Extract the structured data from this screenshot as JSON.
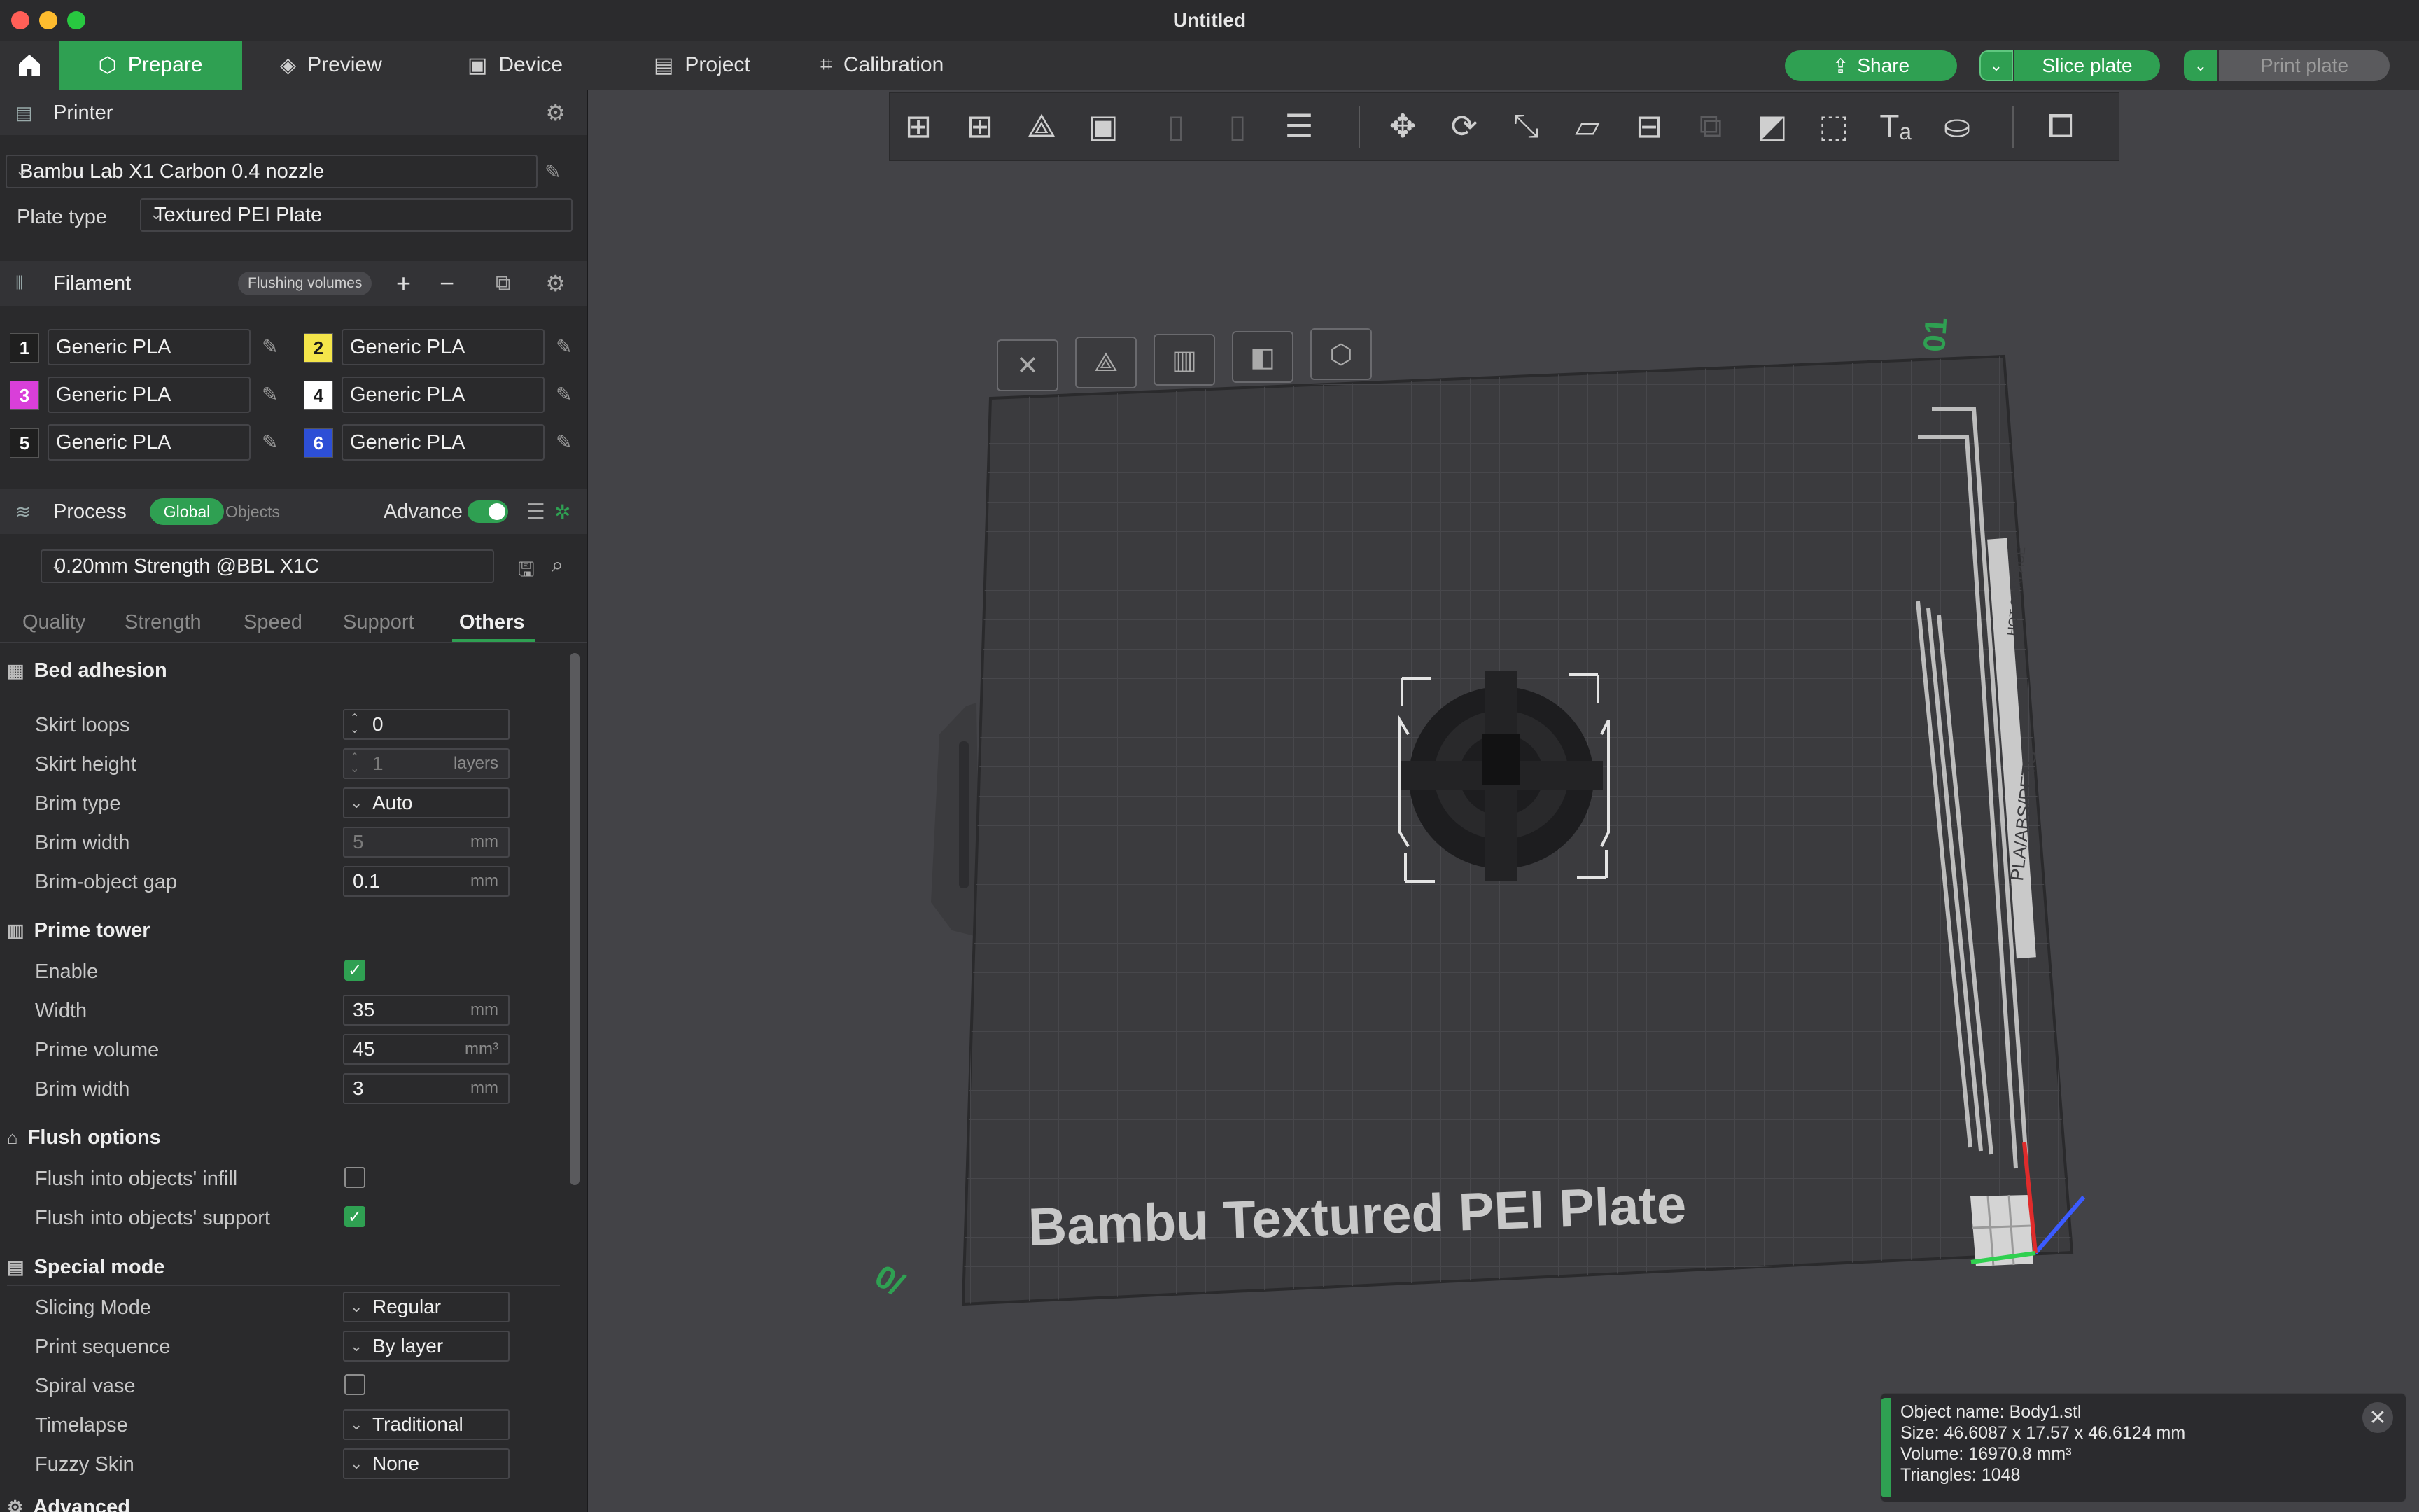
{
  "window": {
    "title": "Untitled"
  },
  "colors": {
    "accent": "#2fa052",
    "close": "#ff5f57",
    "minimize": "#febc2e",
    "zoom": "#28c840"
  },
  "nav": {
    "home_icon": "home-icon",
    "tabs": [
      {
        "label": "Prepare",
        "icon": "cube-icon"
      },
      {
        "label": "Preview",
        "icon": "layers-icon"
      },
      {
        "label": "Device",
        "icon": "device-icon"
      },
      {
        "label": "Project",
        "icon": "project-icon"
      },
      {
        "label": "Calibration",
        "icon": "calibration-icon"
      }
    ],
    "share_label": "Share",
    "slice_label": "Slice plate",
    "print_label": "Print plate"
  },
  "printer": {
    "section_title": "Printer",
    "printer_name": "Bambu Lab X1 Carbon 0.4 nozzle",
    "plate_type_label": "Plate type",
    "plate_type": "Textured PEI Plate"
  },
  "filament": {
    "section_title": "Filament",
    "flushing_label": "Flushing volumes",
    "items": [
      {
        "num": "1",
        "name": "Generic PLA",
        "color": "#1f1f1f",
        "text": "#ffffff"
      },
      {
        "num": "2",
        "name": "Generic PLA",
        "color": "#f4e54a",
        "text": "#1a1a1a"
      },
      {
        "num": "3",
        "name": "Generic PLA",
        "color": "#d93fd9",
        "text": "#ffffff"
      },
      {
        "num": "4",
        "name": "Generic PLA",
        "color": "#ffffff",
        "text": "#1a1a1a"
      },
      {
        "num": "5",
        "name": "Generic PLA",
        "color": "#1f1f1f",
        "text": "#ffffff"
      },
      {
        "num": "6",
        "name": "Generic PLA",
        "color": "#2d4fd6",
        "text": "#ffffff"
      }
    ]
  },
  "process": {
    "section_title": "Process",
    "global_label": "Global",
    "objects_label": "Objects",
    "advance_label": "Advance",
    "preset": "0.20mm Strength @BBL X1C",
    "tabs": [
      "Quality",
      "Strength",
      "Speed",
      "Support",
      "Others"
    ],
    "active_tab": "Others"
  },
  "groups": {
    "bed_adhesion": {
      "title": "Bed adhesion",
      "skirt_loops": {
        "label": "Skirt loops",
        "value": "0"
      },
      "skirt_height": {
        "label": "Skirt height",
        "value": "1",
        "unit": "layers"
      },
      "brim_type": {
        "label": "Brim type",
        "value": "Auto"
      },
      "brim_width": {
        "label": "Brim width",
        "value": "5",
        "unit": "mm"
      },
      "brim_gap": {
        "label": "Brim-object gap",
        "value": "0.1",
        "unit": "mm"
      }
    },
    "prime_tower": {
      "title": "Prime tower",
      "enable": {
        "label": "Enable",
        "checked": true
      },
      "width": {
        "label": "Width",
        "value": "35",
        "unit": "mm"
      },
      "prime_volume": {
        "label": "Prime volume",
        "value": "45",
        "unit": "mm³"
      },
      "brim_width": {
        "label": "Brim width",
        "value": "3",
        "unit": "mm"
      }
    },
    "flush_options": {
      "title": "Flush options",
      "infill": {
        "label": "Flush into objects' infill",
        "checked": false
      },
      "support": {
        "label": "Flush into objects' support",
        "checked": true
      }
    },
    "special_mode": {
      "title": "Special mode",
      "slicing_mode": {
        "label": "Slicing Mode",
        "value": "Regular"
      },
      "print_sequence": {
        "label": "Print sequence",
        "value": "By layer"
      },
      "spiral_vase": {
        "label": "Spiral vase",
        "checked": false
      },
      "timelapse": {
        "label": "Timelapse",
        "value": "Traditional"
      },
      "fuzzy_skin": {
        "label": "Fuzzy Skin",
        "value": "None"
      }
    },
    "advanced": {
      "title": "Advanced"
    }
  },
  "plate": {
    "label": "Bambu Textured PEI Plate",
    "plate_number": "01",
    "side_text": "PLA/ABS/PETG",
    "hot_surface": "HOT SURFACE"
  },
  "object_info": {
    "name": "Object name: Body1.stl",
    "size": "Size: 46.6087 x 17.57 x 46.6124 mm",
    "volume": "Volume: 16970.8 mm³",
    "triangles": "Triangles: 1048"
  }
}
